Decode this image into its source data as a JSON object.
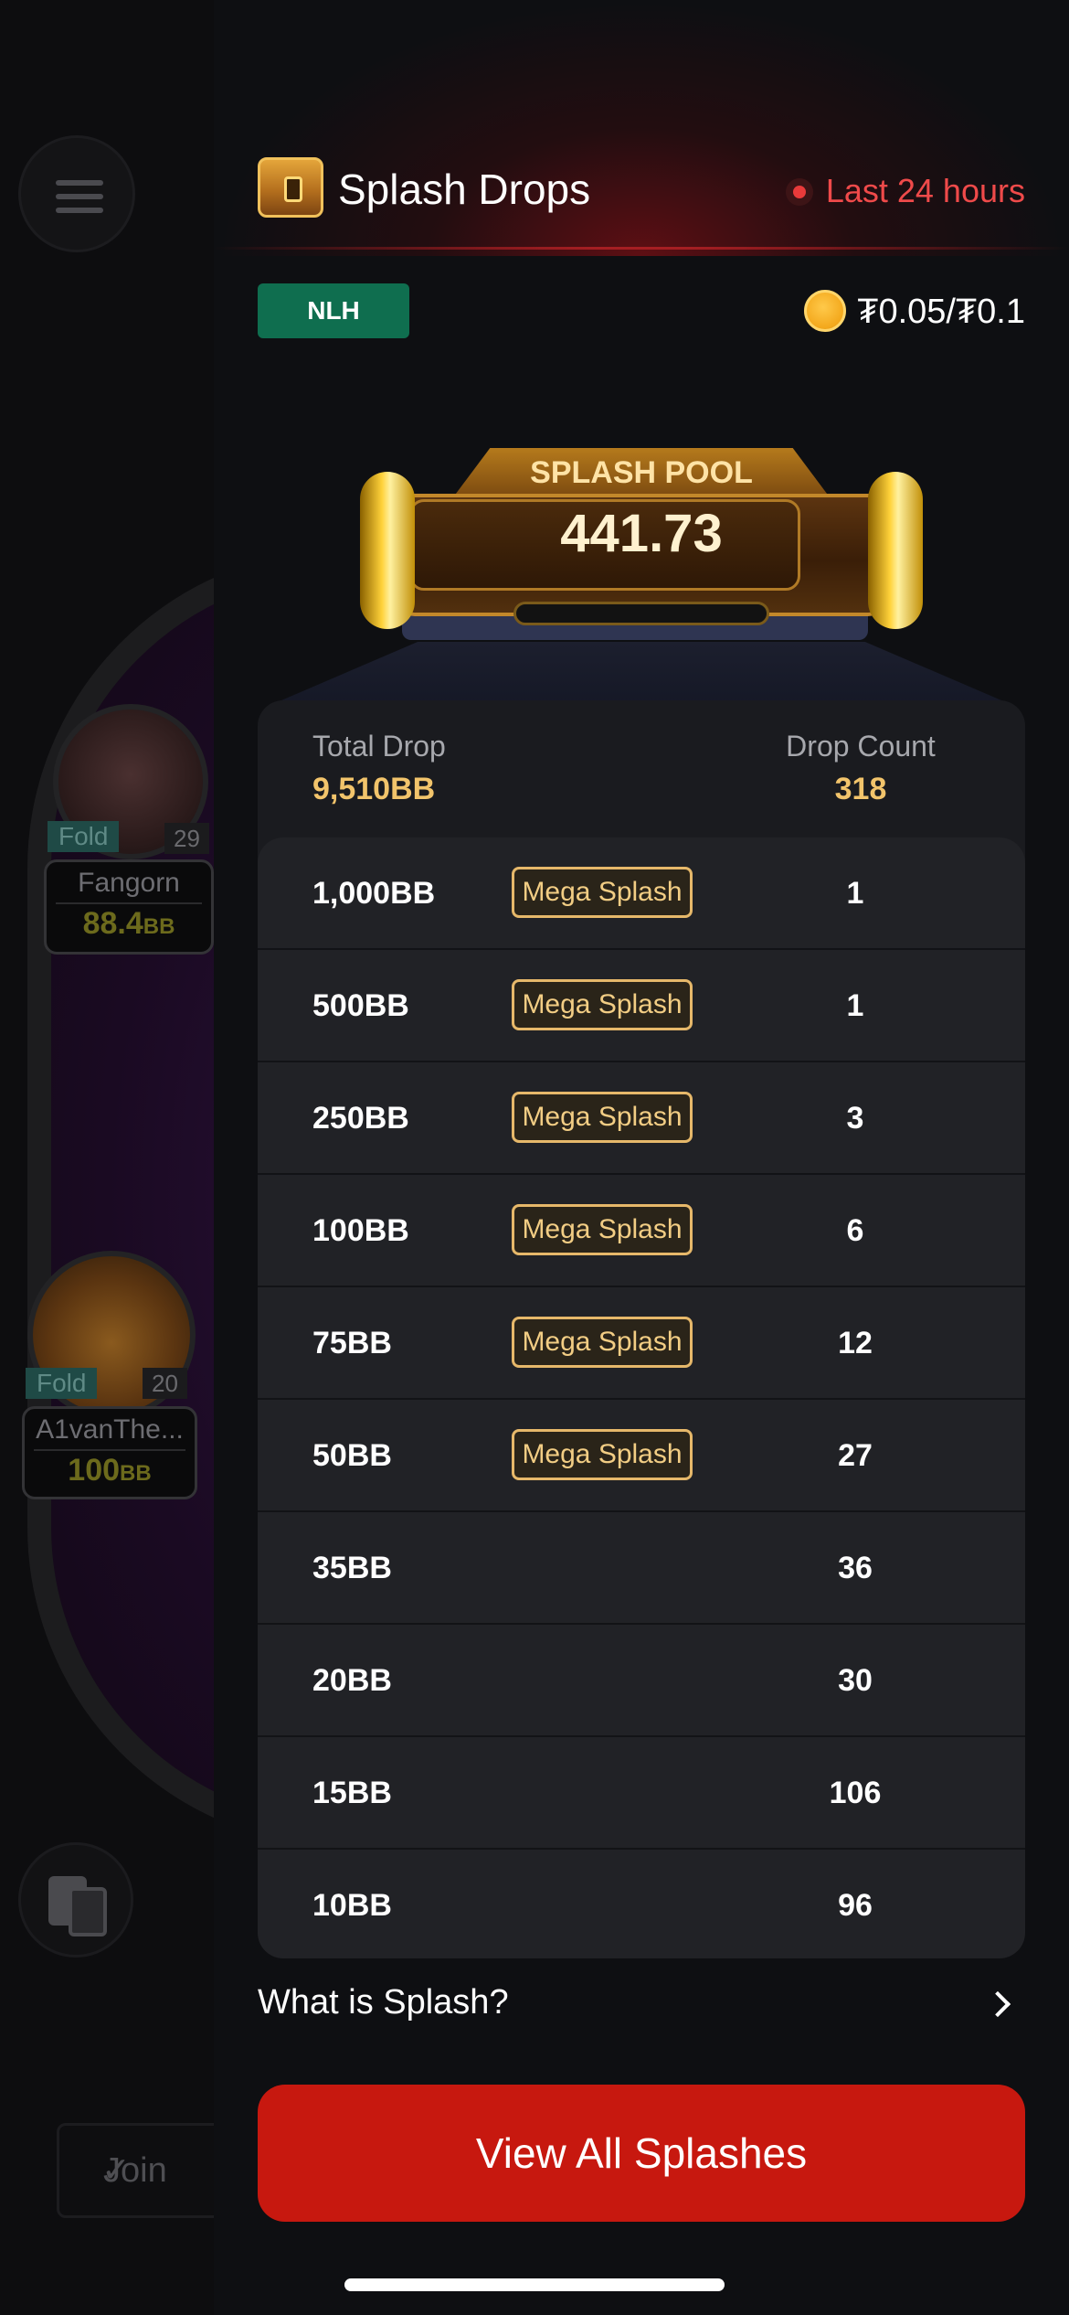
{
  "background": {
    "players": [
      {
        "name": "Fangorn",
        "stack_value": "88.4",
        "stack_unit": "BB",
        "status": "Fold",
        "level": "29"
      },
      {
        "name": "A1vanThe...",
        "stack_value": "100",
        "stack_unit": "BB",
        "status": "Fold",
        "level": "20"
      }
    ],
    "join_label": "Join",
    "menu_icon": "hamburger-icon",
    "cards_icon": "cards-icon"
  },
  "header": {
    "title": "Splash Drops",
    "period": "Last 24 hours",
    "icon": "treasure-chest-icon"
  },
  "filters": {
    "game_type": "NLH",
    "stakes": "₮0.05/₮0.1",
    "currency_icon": "coin-icon"
  },
  "pool": {
    "label": "SPLASH POOL",
    "value": "441.73"
  },
  "summary": {
    "total_drop_label": "Total Drop",
    "total_drop_value": "9,510BB",
    "drop_count_label": "Drop Count",
    "drop_count_value": "318"
  },
  "rows": [
    {
      "amount": "1,000BB",
      "badge": "Mega Splash",
      "count": "1"
    },
    {
      "amount": "500BB",
      "badge": "Mega Splash",
      "count": "1"
    },
    {
      "amount": "250BB",
      "badge": "Mega Splash",
      "count": "3"
    },
    {
      "amount": "100BB",
      "badge": "Mega Splash",
      "count": "6"
    },
    {
      "amount": "75BB",
      "badge": "Mega Splash",
      "count": "12"
    },
    {
      "amount": "50BB",
      "badge": "Mega Splash",
      "count": "27"
    },
    {
      "amount": "35BB",
      "badge": "",
      "count": "36"
    },
    {
      "amount": "20BB",
      "badge": "",
      "count": "30"
    },
    {
      "amount": "15BB",
      "badge": "",
      "count": "106"
    },
    {
      "amount": "10BB",
      "badge": "",
      "count": "96"
    }
  ],
  "help_link": "What is Splash?",
  "cta_label": "View All Splashes",
  "colors": {
    "accent_red": "#c7180f",
    "live_red": "#ef4a4a",
    "gold": "#f2c46b",
    "badge_green": "#0f6e4f"
  }
}
